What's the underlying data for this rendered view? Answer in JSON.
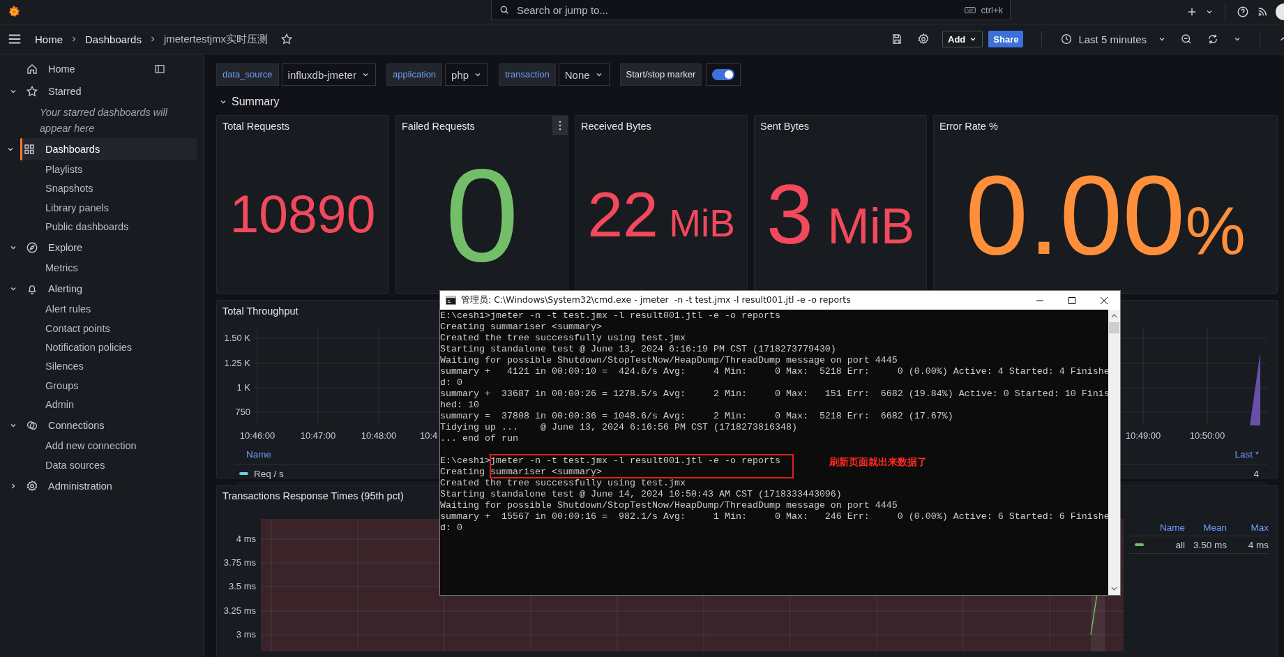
{
  "top_bar": {
    "search": {
      "placeholder": "Search or jump to...",
      "shortcut": "ctrl+k"
    }
  },
  "breadcrumbs": [
    {
      "label": "Home"
    },
    {
      "label": "Dashboards"
    },
    {
      "label": "jmetertestjmx实时压测"
    }
  ],
  "toolbar": {
    "add": "Add",
    "share": "Share",
    "time_range": "Last 5 minutes"
  },
  "sidebar": {
    "items": [
      {
        "label": "Home",
        "selected": false
      },
      {
        "label": "Starred",
        "expanded": true,
        "selected": false,
        "note": "Your starred dashboards will appear here"
      },
      {
        "label": "Dashboards",
        "expanded": true,
        "selected": true,
        "children": [
          {
            "label": "Playlists",
            "selected": false
          },
          {
            "label": "Snapshots",
            "selected": false
          },
          {
            "label": "Library panels",
            "selected": false
          },
          {
            "label": "Public dashboards",
            "selected": false
          }
        ]
      },
      {
        "label": "Explore",
        "expanded": true,
        "selected": false,
        "children": [
          {
            "label": "Metrics",
            "selected": false
          }
        ]
      },
      {
        "label": "Alerting",
        "expanded": true,
        "selected": false,
        "children": [
          {
            "label": "Alert rules",
            "selected": false
          },
          {
            "label": "Contact points",
            "selected": false
          },
          {
            "label": "Notification policies",
            "selected": false
          },
          {
            "label": "Silences",
            "selected": false
          },
          {
            "label": "Groups",
            "selected": false
          },
          {
            "label": "Admin",
            "selected": false
          }
        ]
      },
      {
        "label": "Connections",
        "expanded": true,
        "selected": false,
        "children": [
          {
            "label": "Add new connection",
            "selected": false
          },
          {
            "label": "Data sources",
            "selected": false
          }
        ]
      },
      {
        "label": "Administration",
        "expanded": false,
        "selected": false
      }
    ]
  },
  "variables": [
    {
      "label": "data_source",
      "value": "influxdb-jmeter"
    },
    {
      "label": "application",
      "value": "php"
    },
    {
      "label": "transaction",
      "value": "None"
    }
  ],
  "marker_toggle": {
    "label": "Start/stop marker",
    "on": true
  },
  "row": {
    "title": "Summary",
    "expanded": true
  },
  "stats": [
    {
      "title": "Total Requests",
      "value": "10890",
      "color": "#f2495c",
      "hovered": false
    },
    {
      "title": "Failed Requests",
      "value": "0",
      "color": "#73bf69",
      "hovered": true
    },
    {
      "title": "Received Bytes",
      "value": "22",
      "unit": "MiB",
      "color": "#f2495c",
      "hovered": false
    },
    {
      "title": "Sent Bytes",
      "value": "3",
      "unit": "MiB",
      "color": "#f2495c",
      "hovered": false
    },
    {
      "title": "Error Rate %",
      "value": "0.00",
      "unit": "%",
      "color": "#ff8f3a",
      "hovered": false
    }
  ],
  "throughput": {
    "title": "Total Throughput",
    "y_ticks": [
      "1.50 K",
      "1.25 K",
      "1 K",
      "750"
    ],
    "x_ticks_start": [
      "10:46:00",
      "10:47:00",
      "10:48:00",
      "10:4"
    ],
    "x_ticks_end": [
      "10:49:00",
      "10:50:00"
    ],
    "legend": {
      "name_header": "Name",
      "value_header": "Last *",
      "rows": [
        {
          "name": "Req / s",
          "color": "#6ed0e0",
          "value": "4"
        }
      ]
    }
  },
  "response_times": {
    "title": "Transactions Response Times (95th pct)",
    "y_ticks": [
      "4 ms",
      "3.75 ms",
      "3.5 ms",
      "3.25 ms",
      "3 ms"
    ],
    "legend": {
      "headers": [
        "Name",
        "Mean",
        "Max"
      ],
      "rows": [
        {
          "name": "all",
          "color": "#73bf69",
          "mean": "3.50 ms",
          "max": "4 ms"
        }
      ]
    }
  },
  "console": {
    "title": "管理员: C:\\Windows\\System32\\cmd.exe - jmeter  -n -t test.jmx -l result001.jtl -e -o reports",
    "blocks": [
      {
        "boxed": false,
        "lines": [
          "E:\\ceshi>jmeter -n -t test.jmx -l result001.jtl -e -o reports",
          "Creating summariser <summary>",
          "Created the tree successfully using test.jmx",
          "Starting standalone test @ June 13, 2024 6:16:19 PM CST (1718273779430)",
          "Waiting for possible Shutdown/StopTestNow/HeapDump/ThreadDump message on port 4445",
          "summary +   4121 in 00:00:10 =  424.6/s Avg:     4 Min:     0 Max:  5218 Err:     0 (0.00%) Active: 4 Started: 4 Finishe",
          "d: 0",
          "summary +  33687 in 00:00:26 = 1278.5/s Avg:     2 Min:     0 Max:   151 Err:  6682 (19.84%) Active: 0 Started: 10 Finis",
          "hed: 10",
          "summary =  37808 in 00:00:36 = 1048.6/s Avg:     2 Min:     0 Max:  5218 Err:  6682 (17.67%)",
          "Tidying up ...    @ June 13, 2024 6:16:56 PM CST (1718273816348)",
          "... end of run"
        ]
      },
      {
        "boxed": true,
        "note": "刷新页面就出来数据了",
        "lines": [
          "E:\\ceshi>jmeter -n -t test.jmx -l result001.jtl -e -o reports",
          "Creating summariser <summary>",
          "Created the tree successfully using test.jmx",
          "Starting standalone test @ June 14, 2024 10:50:43 AM CST (1718333443096)",
          "Waiting for possible Shutdown/StopTestNow/HeapDump/ThreadDump message on port 4445",
          "summary +  15567 in 00:00:16 =  982.1/s Avg:     1 Min:     0 Max:   246 Err:     0 (0.00%) Active: 6 Started: 6 Finishe",
          "d: 0"
        ]
      }
    ]
  }
}
